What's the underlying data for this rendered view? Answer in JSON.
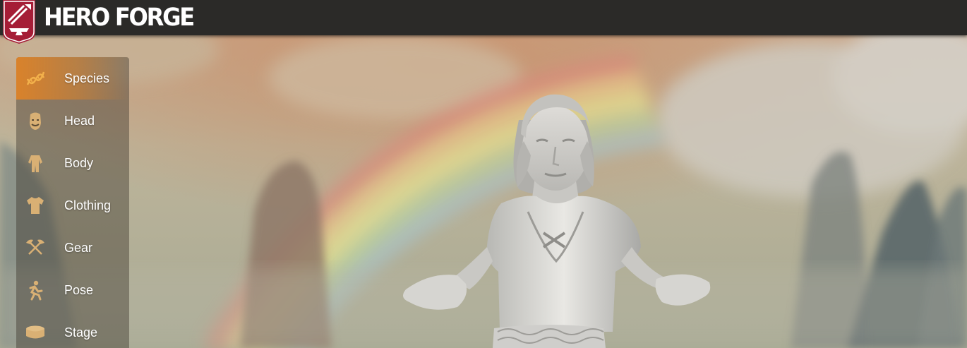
{
  "app": {
    "brand": "HERO FORGE",
    "accent_color": "#d9822b",
    "logo_color": "#a51d36"
  },
  "menu": {
    "active": "Species",
    "items": [
      {
        "label": "Species",
        "icon": "dna-icon"
      },
      {
        "label": "Head",
        "icon": "head-icon"
      },
      {
        "label": "Body",
        "icon": "body-icon"
      },
      {
        "label": "Clothing",
        "icon": "shirt-icon"
      },
      {
        "label": "Gear",
        "icon": "crossed-axes-icon"
      },
      {
        "label": "Pose",
        "icon": "running-figure-icon"
      },
      {
        "label": "Stage",
        "icon": "base-icon"
      }
    ]
  },
  "viewport": {
    "background": "rainbow-cliffs",
    "model": "miniature-figure"
  }
}
